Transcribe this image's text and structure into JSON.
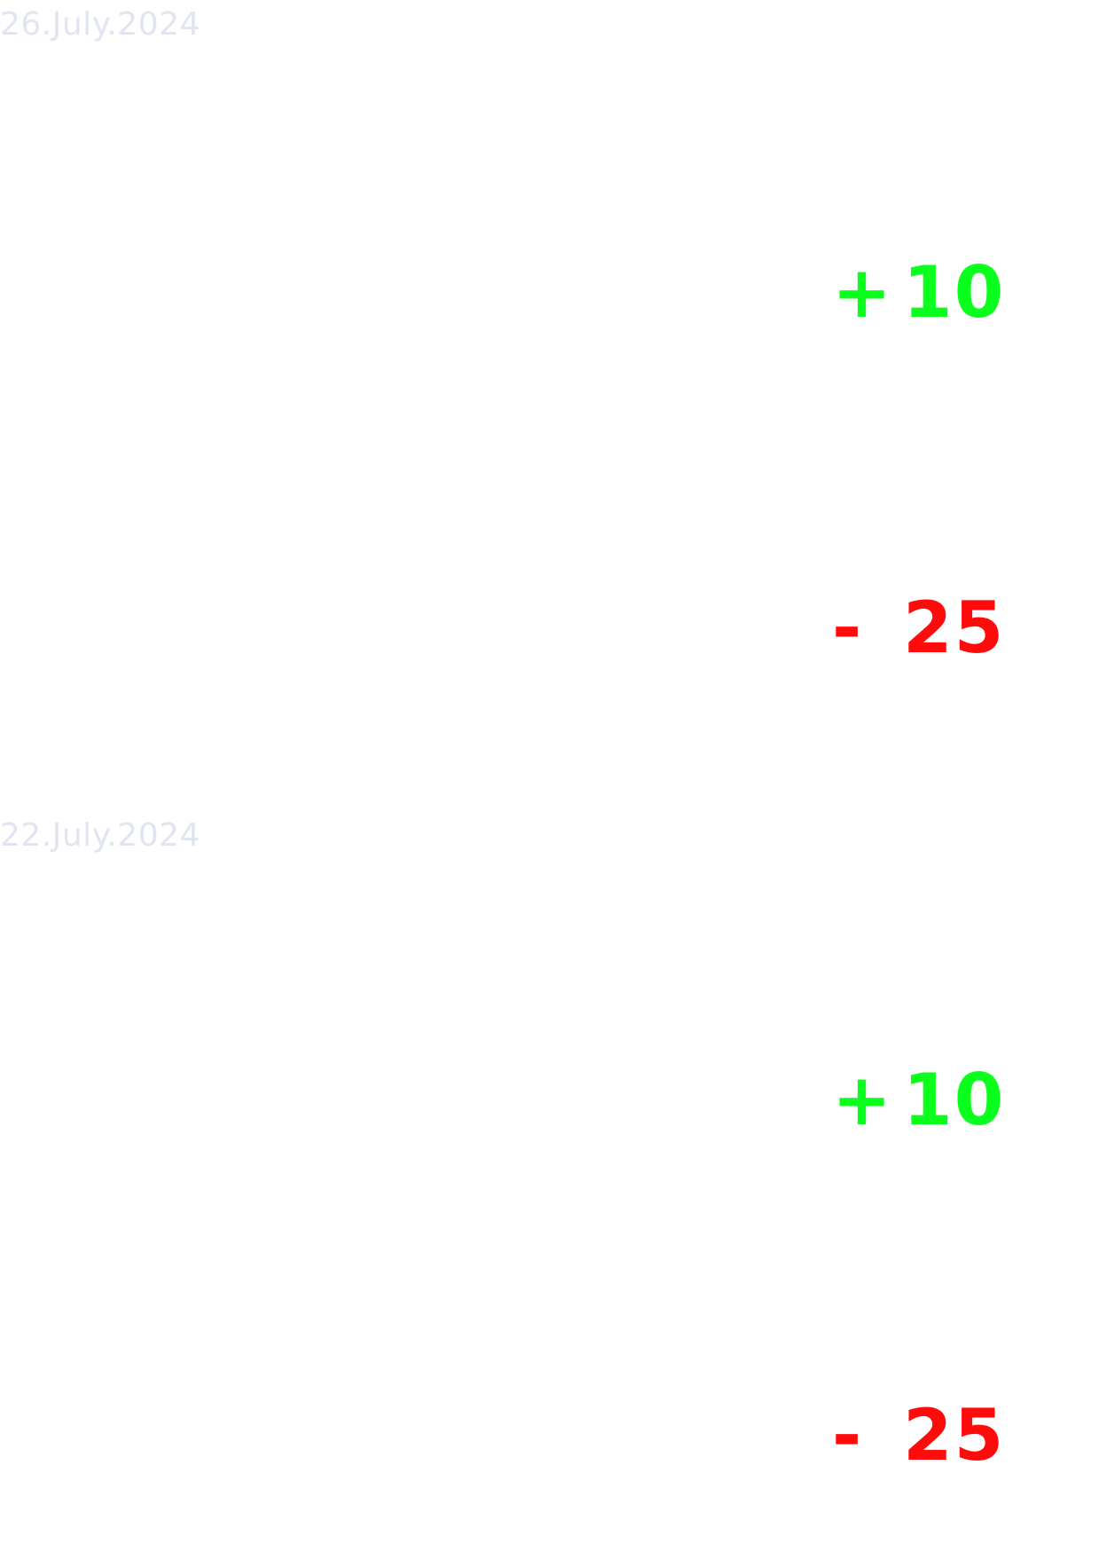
{
  "groups": [
    {
      "date": "26.July.2024",
      "transactions": [
        {
          "sign": "+",
          "amount": "10",
          "color": "#0bff1c"
        },
        {
          "sign": "-",
          "amount": "25",
          "color": "#ff0b0b"
        }
      ]
    },
    {
      "date": "22.July.2024",
      "transactions": [
        {
          "sign": "+",
          "amount": "10",
          "color": "#0bff1c"
        },
        {
          "sign": "-",
          "amount": "25",
          "color": "#ff0b0b"
        }
      ]
    }
  ]
}
